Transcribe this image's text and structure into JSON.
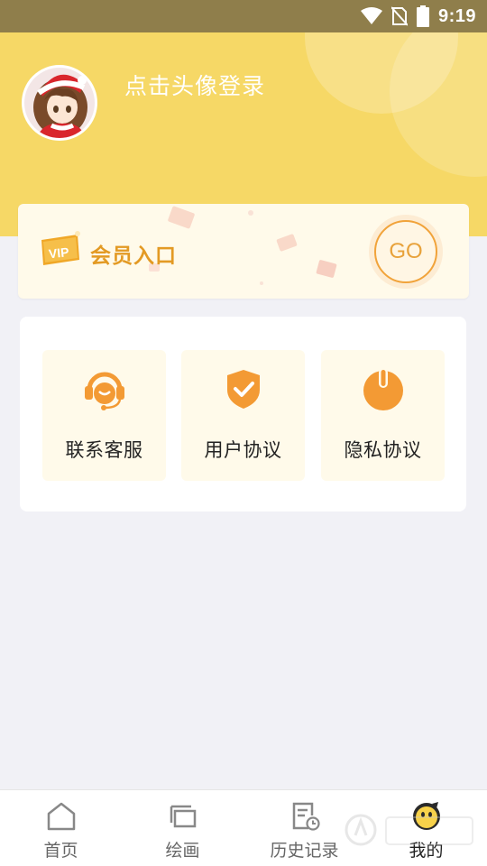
{
  "status_bar": {
    "time": "9:19",
    "icons": [
      "wifi-icon",
      "no-sim-icon",
      "battery-icon"
    ]
  },
  "header": {
    "login_prompt": "点击头像登录",
    "avatar": "avatar-image"
  },
  "vip": {
    "badge_text": "VIP",
    "title": "会员入口",
    "go_label": "GO"
  },
  "services": [
    {
      "label": "联系客服",
      "icon": "headset-icon"
    },
    {
      "label": "用户协议",
      "icon": "shield-check-icon"
    },
    {
      "label": "隐私协议",
      "icon": "power-icon"
    }
  ],
  "bottom_nav": [
    {
      "label": "首页",
      "icon": "home-icon",
      "active": false
    },
    {
      "label": "绘画",
      "icon": "gallery-icon",
      "active": false
    },
    {
      "label": "历史记录",
      "icon": "history-icon",
      "active": false
    },
    {
      "label": "我的",
      "icon": "profile-face-icon",
      "active": true
    }
  ],
  "colors": {
    "header_bg": "#f6d866",
    "status_bar_bg": "#8f7e4b",
    "accent_orange": "#f39a34",
    "vip_text": "#e39a24",
    "card_bg": "#fffaea",
    "page_bg": "#f1f1f6"
  }
}
